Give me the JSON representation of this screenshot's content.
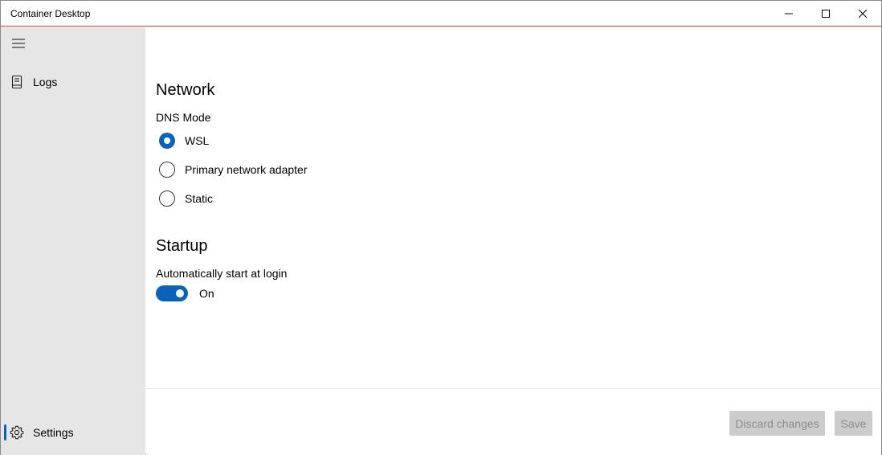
{
  "window": {
    "title": "Container Desktop"
  },
  "caption_buttons": {
    "minimize_icon": "minimize-icon",
    "maximize_icon": "maximize-icon",
    "close_icon": "close-icon"
  },
  "sidebar": {
    "menu_icon": "hamburger-menu-icon",
    "items": [
      {
        "label": "Logs",
        "icon": "document-icon"
      },
      {
        "label": "Settings",
        "icon": "gear-icon",
        "selected": true
      }
    ]
  },
  "network": {
    "title": "Network",
    "dns_label": "DNS Mode",
    "options": [
      {
        "label": "WSL",
        "checked": true
      },
      {
        "label": "Primary network adapter",
        "checked": false
      },
      {
        "label": "Static",
        "checked": false
      }
    ]
  },
  "startup": {
    "title": "Startup",
    "auto_start_label": "Automatically start at login",
    "toggle_state": "On"
  },
  "footer": {
    "discard_label": "Discard changes",
    "save_label": "Save"
  },
  "colors": {
    "accent": "#0a63b8",
    "sidebar_bg": "#e6e6e6",
    "title_border": "#d13438",
    "disabled_button_bg": "#cccccc",
    "disabled_button_text": "#8d8d8d"
  }
}
